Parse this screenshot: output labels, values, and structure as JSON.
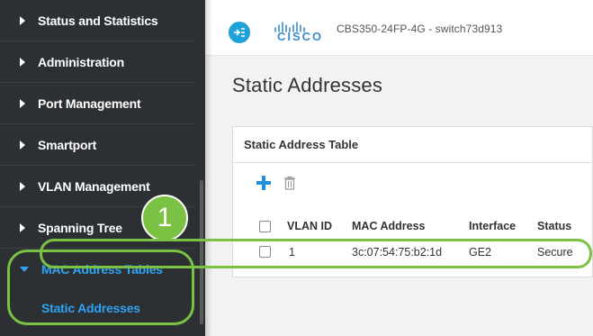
{
  "sidebar": {
    "items": [
      {
        "label": "Status and Statistics"
      },
      {
        "label": "Administration"
      },
      {
        "label": "Port Management"
      },
      {
        "label": "Smartport"
      },
      {
        "label": "VLAN Management"
      },
      {
        "label": "Spanning Tree"
      },
      {
        "label": "MAC Address Tables"
      }
    ],
    "subitem": {
      "label": "Static Addresses"
    }
  },
  "annotation": {
    "step_number": "1",
    "accent_color": "#7bc143"
  },
  "header": {
    "logo_icon": "cisco-app-icon",
    "brand": "CISCO",
    "device": "CBS350-24FP-4G - switch73d913"
  },
  "main": {
    "page_title": "Static Addresses",
    "table": {
      "title": "Static Address Table",
      "columns": [
        "VLAN ID",
        "MAC Address",
        "Interface",
        "Status"
      ],
      "rows": [
        {
          "vlan_id": "1",
          "mac": "3c:07:54:75:b2:1d",
          "interface": "GE2",
          "status": "Secure"
        }
      ]
    }
  },
  "colors": {
    "sidebar_bg": "#2d3033",
    "active_nav": "#2ea3f2",
    "add_icon": "#1f8fe0"
  }
}
